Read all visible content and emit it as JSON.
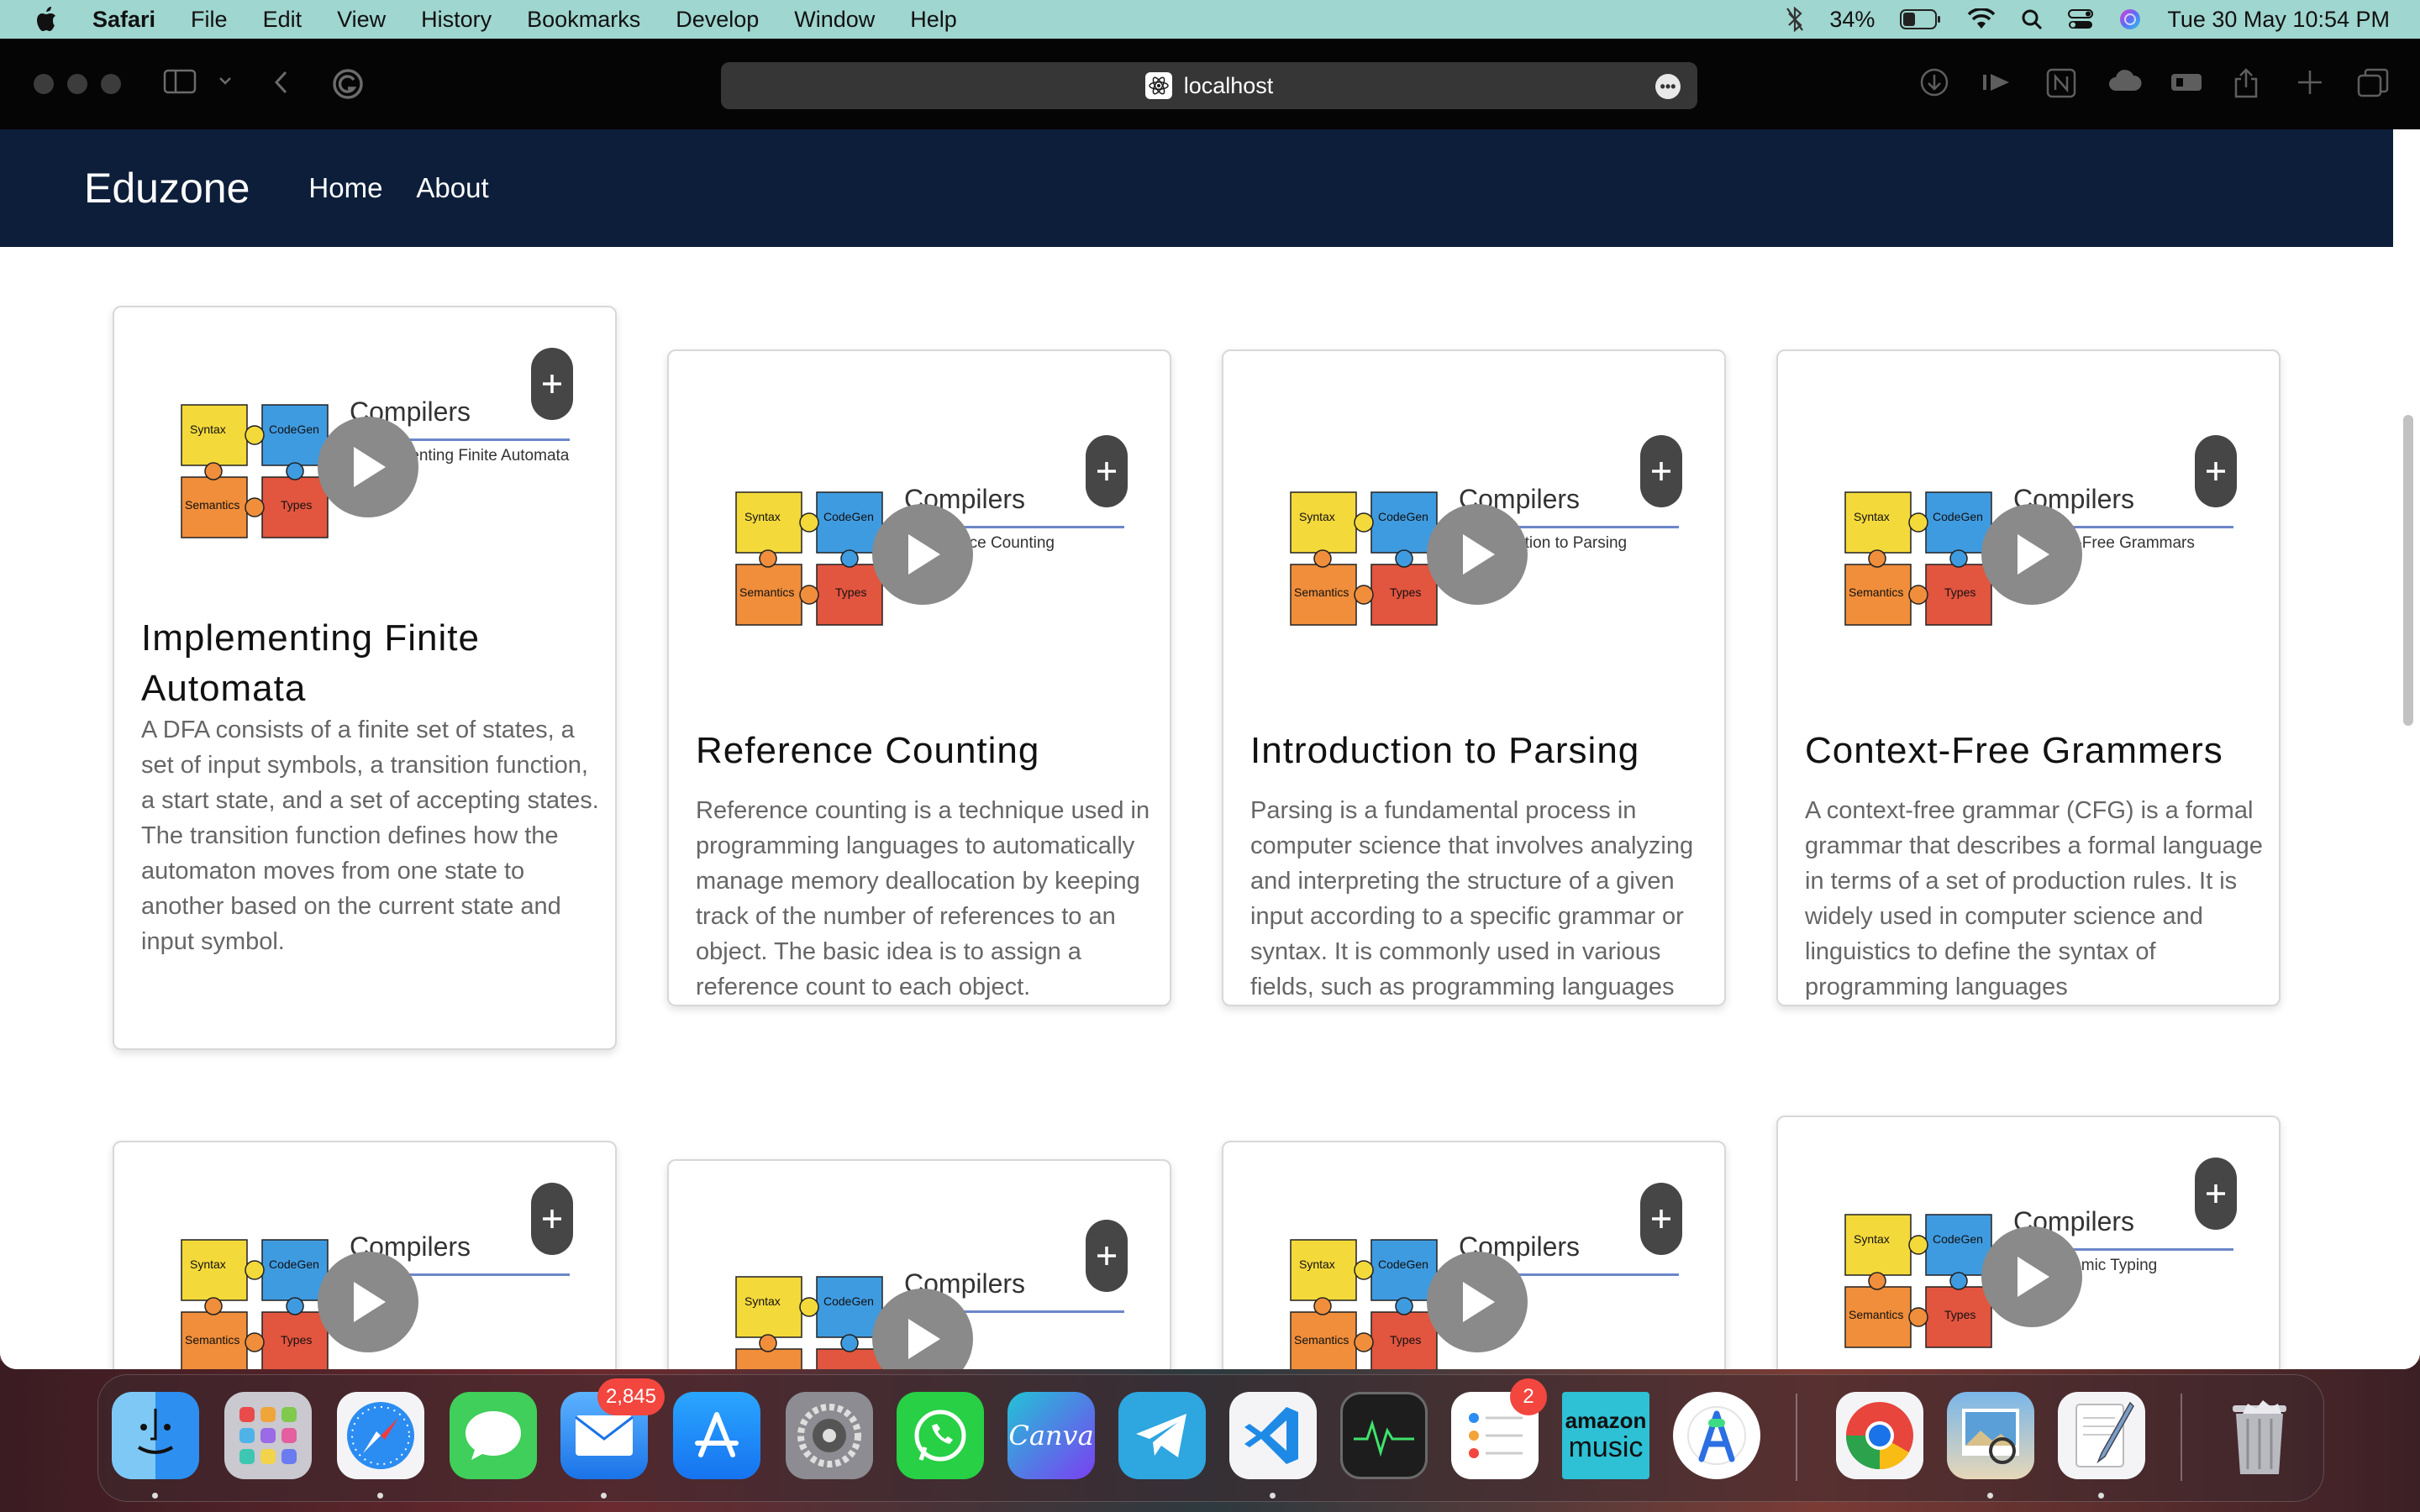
{
  "menubar": {
    "app_name": "Safari",
    "items": [
      "File",
      "Edit",
      "View",
      "History",
      "Bookmarks",
      "Develop",
      "Window",
      "Help"
    ],
    "battery": "34%",
    "datetime": "Tue 30 May  10:54 PM"
  },
  "browser": {
    "url": "localhost"
  },
  "site": {
    "brand": "Eduzone",
    "nav": [
      "Home",
      "About"
    ]
  },
  "slide": {
    "title": "Compilers",
    "pieces": [
      "Syntax",
      "CodeGen",
      "Semantics",
      "Types"
    ]
  },
  "cards": [
    {
      "title": "Implementing Finite Automata",
      "slide_subtitle": "Implementing Finite Automata",
      "description": "A DFA consists of a finite set of states, a set of input symbols, a transition function, a start state, and a set of accepting states. The transition function defines how the automaton moves from one state to another based on the current state and input symbol."
    },
    {
      "title": "Reference Counting",
      "slide_subtitle": "Reference Counting",
      "description": "Reference counting is a technique used in programming languages to automatically manage memory deallocation by keeping track of the number of references to an object. The basic idea is to assign a reference count to each object."
    },
    {
      "title": "Introduction to Parsing",
      "slide_subtitle": "Introduction to Parsing",
      "description": "Parsing is a fundamental process in computer science that involves analyzing and interpreting the structure of a given input according to a specific grammar or syntax. It is commonly used in various fields, such as programming languages"
    },
    {
      "title": "Context-Free Grammers",
      "slide_subtitle": "Context-Free Grammars",
      "description": "A context-free grammar (CFG) is a formal grammar that describes a formal language in terms of a set of production rules. It is widely used in computer science and linguistics to define the syntax of programming languages"
    },
    {
      "slide_subtitle": "uity"
    },
    {
      "slide_subtitle": "andling"
    },
    {
      "slide_subtitle": "hecking"
    },
    {
      "slide_subtitle": "rs. Dynamic Typing"
    }
  ],
  "dock": {
    "mail_badge": "2,845",
    "reminders_badge": "2",
    "amazon_top": "amazon",
    "amazon_bottom": "music",
    "canva_label": "Canva"
  }
}
